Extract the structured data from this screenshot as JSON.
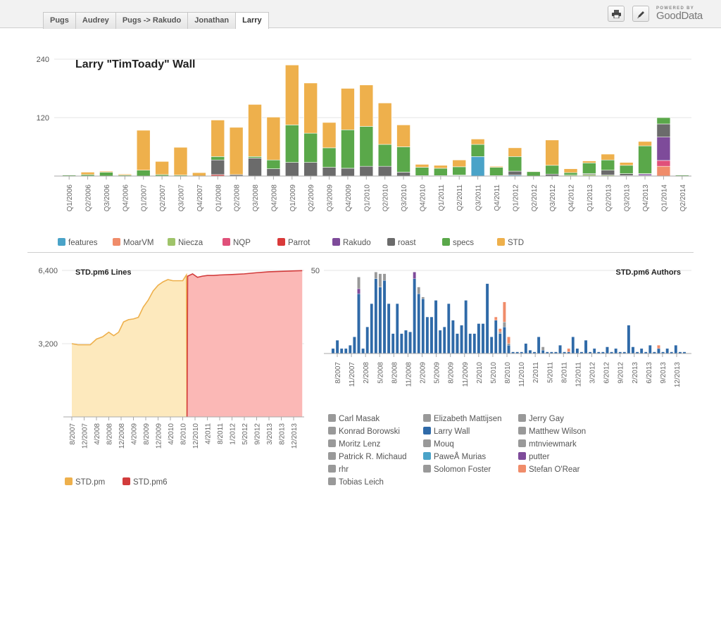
{
  "tabs": [
    "Pugs",
    "Audrey",
    "Pugs -> Rakudo",
    "Jonathan",
    "Larry"
  ],
  "active_tab": "Larry",
  "toolbar": {
    "print_icon": "printer-icon",
    "edit_icon": "pencil-icon"
  },
  "logo": {
    "powered_by": "POWERED BY",
    "brand": "GoodData"
  },
  "colors": {
    "features": "#4aa3c8",
    "MoarVM": "#f08c6a",
    "Niecza": "#9fc46a",
    "NQP": "#e0507a",
    "Parrot": "#d93a3a",
    "Rakudo": "#7e4b9a",
    "roast": "#6b6b6b",
    "specs": "#5aa84a",
    "STD": "#eeb04c",
    "std_pm_fill": "#fde9bd",
    "std_pm6_fill": "#fbb8b6",
    "std_pm6_line": "#d23c3c",
    "larry": "#2f6aa8",
    "grey": "#999999",
    "paweł": "#4aa3c8",
    "putter": "#7e4b9a",
    "stefan": "#f08c6a"
  },
  "chart_data": [
    {
      "type": "bar",
      "stacked": true,
      "title": "Larry \"TimToady\" Wall",
      "ylim": [
        0,
        240
      ],
      "yticks": [
        "240",
        "120"
      ],
      "categories": [
        "Q1/2006",
        "Q2/2006",
        "Q3/2006",
        "Q4/2006",
        "Q1/2007",
        "Q2/2007",
        "Q3/2007",
        "Q4/2007",
        "Q1/2008",
        "Q2/2008",
        "Q3/2008",
        "Q4/2008",
        "Q1/2009",
        "Q2/2009",
        "Q3/2009",
        "Q4/2009",
        "Q1/2010",
        "Q2/2010",
        "Q3/2010",
        "Q4/2010",
        "Q1/2011",
        "Q2/2011",
        "Q3/2011",
        "Q4/2011",
        "Q1/2012",
        "Q2/2012",
        "Q3/2012",
        "Q4/2012",
        "Q1/2013",
        "Q2/2013",
        "Q3/2013",
        "Q4/2013",
        "Q1/2014",
        "Q2/2014"
      ],
      "series": [
        {
          "name": "features",
          "values": [
            0,
            0,
            0,
            0,
            0,
            0,
            0,
            0,
            0,
            0,
            0,
            0,
            0,
            0,
            0,
            0,
            0,
            0,
            0,
            0,
            0,
            0,
            40,
            0,
            2,
            0,
            0,
            0,
            0,
            0,
            0,
            0,
            0,
            0
          ]
        },
        {
          "name": "MoarVM",
          "values": [
            0,
            0,
            0,
            0,
            0,
            0,
            0,
            0,
            0,
            0,
            0,
            0,
            0,
            0,
            0,
            0,
            0,
            0,
            0,
            0,
            0,
            0,
            0,
            0,
            0,
            0,
            0,
            0,
            0,
            0,
            0,
            0,
            20,
            0
          ]
        },
        {
          "name": "Niecza",
          "values": [
            0,
            0,
            0,
            0,
            0,
            0,
            0,
            0,
            0,
            0,
            0,
            0,
            0,
            0,
            0,
            0,
            0,
            0,
            0,
            0,
            0,
            1,
            0,
            0,
            0,
            0,
            0,
            2,
            3,
            2,
            1,
            1,
            0,
            0
          ]
        },
        {
          "name": "NQP",
          "values": [
            0,
            0,
            0,
            0,
            0,
            0,
            0,
            0,
            0,
            0,
            0,
            0,
            0,
            0,
            0,
            0,
            0,
            0,
            0,
            0,
            0,
            0,
            0,
            0,
            0,
            0,
            0,
            0,
            0,
            0,
            0,
            0,
            12,
            0
          ]
        },
        {
          "name": "Parrot",
          "values": [
            0,
            0,
            0,
            0,
            0,
            0,
            0,
            0,
            3,
            0,
            0,
            0,
            0,
            0,
            0,
            0,
            0,
            0,
            0,
            0,
            0,
            0,
            0,
            0,
            0,
            0,
            0,
            0,
            0,
            0,
            0,
            0,
            0,
            0
          ]
        },
        {
          "name": "Rakudo",
          "values": [
            0,
            0,
            0,
            0,
            0,
            0,
            0,
            0,
            0,
            0,
            0,
            0,
            0,
            0,
            0,
            0,
            0,
            0,
            0,
            0,
            0,
            0,
            0,
            0,
            0,
            0,
            0,
            0,
            0,
            0,
            0,
            3,
            48,
            0
          ]
        },
        {
          "name": "roast",
          "values": [
            0,
            0,
            0,
            0,
            0,
            0,
            0,
            0,
            30,
            3,
            37,
            15,
            28,
            28,
            18,
            16,
            20,
            20,
            8,
            1,
            1,
            1,
            0,
            1,
            8,
            0,
            4,
            0,
            2,
            10,
            4,
            1,
            27,
            0
          ]
        },
        {
          "name": "specs",
          "values": [
            2,
            3,
            8,
            2,
            12,
            3,
            2,
            0,
            7,
            0,
            3,
            18,
            77,
            60,
            40,
            79,
            82,
            45,
            52,
            17,
            15,
            17,
            25,
            17,
            30,
            9,
            18,
            5,
            22,
            21,
            17,
            57,
            13,
            2
          ]
        },
        {
          "name": "STD",
          "values": [
            0,
            5,
            2,
            2,
            82,
            27,
            57,
            7,
            75,
            97,
            107,
            88,
            123,
            103,
            52,
            85,
            85,
            85,
            45,
            6,
            6,
            14,
            11,
            2,
            18,
            1,
            52,
            8,
            4,
            12,
            6,
            9,
            0,
            0
          ]
        }
      ]
    },
    {
      "type": "area",
      "title": "STD.pm6 Lines",
      "ylim": [
        0,
        6400
      ],
      "yticks": [
        "6,400",
        "3,200"
      ],
      "xticks": [
        "8/2007",
        "12/2007",
        "4/2008",
        "8/2008",
        "12/2008",
        "4/2009",
        "8/2009",
        "12/2009",
        "4/2010",
        "8/2010",
        "12/2010",
        "4/2011",
        "8/2011",
        "1/2012",
        "5/2012",
        "9/2012",
        "3/2013",
        "8/2013",
        "12/2013"
      ],
      "series": [
        {
          "name": "STD.pm",
          "points": [
            [
              0,
              3200
            ],
            [
              0.5,
              3150
            ],
            [
              1,
              3150
            ],
            [
              1.5,
              3150
            ],
            [
              2,
              3400
            ],
            [
              2.5,
              3500
            ],
            [
              3,
              3700
            ],
            [
              3.4,
              3550
            ],
            [
              3.8,
              3700
            ],
            [
              4.2,
              4150
            ],
            [
              4.6,
              4250
            ],
            [
              5,
              4280
            ],
            [
              5.4,
              4350
            ],
            [
              5.8,
              4800
            ],
            [
              6.2,
              5100
            ],
            [
              6.6,
              5500
            ],
            [
              7,
              5750
            ],
            [
              7.4,
              5900
            ],
            [
              7.8,
              6000
            ],
            [
              8.2,
              5950
            ],
            [
              8.6,
              5950
            ],
            [
              9,
              5950
            ],
            [
              9.3,
              6200
            ],
            [
              9.35,
              0
            ]
          ]
        },
        {
          "name": "STD.pm6",
          "points": [
            [
              9.35,
              0
            ],
            [
              9.4,
              6150
            ],
            [
              9.8,
              6250
            ],
            [
              10.2,
              6100
            ],
            [
              10.6,
              6150
            ],
            [
              11,
              6180
            ],
            [
              11.5,
              6180
            ],
            [
              12,
              6200
            ],
            [
              13,
              6220
            ],
            [
              14,
              6250
            ],
            [
              15,
              6300
            ],
            [
              16,
              6340
            ],
            [
              17,
              6360
            ],
            [
              18,
              6380
            ],
            [
              18.7,
              6390
            ]
          ]
        }
      ]
    },
    {
      "type": "bar",
      "stacked": true,
      "title": "STD.pm6 Authors",
      "ylim": [
        0,
        50
      ],
      "yticks": [
        "50"
      ],
      "xticks": [
        "8/2007",
        "11/2007",
        "2/2008",
        "5/2008",
        "8/2008",
        "11/2008",
        "2/2009",
        "5/2009",
        "8/2009",
        "11/2009",
        "2/2010",
        "5/2010",
        "8/2010",
        "11/2010",
        "2/2011",
        "5/2011",
        "8/2011",
        "12/2011",
        "3/2012",
        "6/2012",
        "9/2012",
        "2/2013",
        "6/2013",
        "9/2013",
        "12/2013"
      ],
      "larry_wall": [
        3,
        8,
        3,
        3,
        5,
        10,
        36,
        3,
        16,
        30,
        45,
        40,
        44,
        30,
        12,
        30,
        12,
        14,
        13,
        45,
        36,
        33,
        22,
        22,
        32,
        14,
        16,
        30,
        20,
        12,
        17,
        32,
        12,
        12,
        18,
        18,
        42,
        10,
        20,
        12,
        16,
        5,
        1,
        1,
        1,
        6,
        2,
        1,
        10,
        2,
        1,
        1,
        1,
        5,
        1,
        1,
        10,
        3,
        1,
        8,
        1,
        3,
        1,
        1,
        4,
        1,
        3,
        1,
        1,
        17,
        4,
        1,
        3,
        1,
        5,
        1,
        3,
        1,
        3,
        1,
        5,
        1,
        1
      ],
      "other_authors": [
        0,
        0,
        0,
        0,
        0,
        0,
        7,
        0,
        0,
        0,
        4,
        8,
        4,
        0,
        0,
        0,
        0,
        0,
        0,
        0,
        4,
        1,
        0,
        0,
        0,
        0,
        0,
        0,
        0,
        0,
        0,
        0,
        0,
        0,
        0,
        0,
        0,
        0,
        0,
        1,
        3,
        1,
        0,
        0,
        0,
        0,
        0,
        0,
        0,
        2,
        0,
        0,
        0,
        0,
        0,
        0,
        0,
        0,
        0,
        0,
        0,
        0,
        0,
        0,
        0,
        0,
        0,
        0,
        0,
        0,
        0,
        0,
        0,
        0,
        0,
        0,
        0,
        0,
        0,
        0,
        0,
        0,
        0
      ],
      "stefan_orear": [
        0,
        0,
        0,
        0,
        0,
        0,
        0,
        0,
        0,
        0,
        0,
        0,
        0,
        0,
        0,
        0,
        0,
        0,
        0,
        0,
        0,
        0,
        0,
        0,
        0,
        0,
        0,
        0,
        0,
        0,
        0,
        0,
        0,
        0,
        0,
        0,
        0,
        0,
        2,
        2,
        12,
        4,
        0,
        0,
        0,
        0,
        0,
        0,
        0,
        0,
        0,
        0,
        0,
        0,
        0,
        2,
        0,
        0,
        0,
        0,
        0,
        0,
        0,
        0,
        0,
        0,
        0,
        0,
        0,
        0,
        0,
        0,
        0,
        0,
        0,
        0,
        2,
        0,
        0,
        0,
        0,
        0,
        0
      ],
      "putter": [
        0,
        0,
        0,
        0,
        0,
        0,
        3,
        0,
        0,
        0,
        0,
        0,
        0,
        0,
        0,
        0,
        0,
        0,
        0,
        4,
        0,
        0,
        0,
        0,
        0,
        0,
        0,
        0,
        0,
        0,
        0,
        0,
        0,
        0,
        0,
        0,
        0,
        0,
        0,
        0,
        0,
        0,
        0,
        0,
        0,
        0,
        0,
        0,
        0,
        0,
        0,
        0,
        0,
        0,
        0,
        0,
        0,
        0,
        0,
        0,
        0,
        0,
        0,
        0,
        0,
        0,
        0,
        0,
        0,
        0,
        0,
        0,
        0,
        0,
        0,
        0,
        0,
        0,
        0,
        0,
        0,
        0,
        0
      ]
    }
  ],
  "legend1": [
    {
      "label": "features",
      "color": "#4aa3c8"
    },
    {
      "label": "MoarVM",
      "color": "#f08c6a"
    },
    {
      "label": "Niecza",
      "color": "#9fc46a"
    },
    {
      "label": "NQP",
      "color": "#e0507a"
    },
    {
      "label": "Parrot",
      "color": "#d93a3a"
    },
    {
      "label": "Rakudo",
      "color": "#7e4b9a"
    },
    {
      "label": "roast",
      "color": "#6b6b6b"
    },
    {
      "label": "specs",
      "color": "#5aa84a"
    },
    {
      "label": "STD",
      "color": "#eeb04c"
    }
  ],
  "legend2": [
    {
      "label": "STD.pm",
      "color": "#eeb04c"
    },
    {
      "label": "STD.pm6",
      "color": "#d23c3c"
    }
  ],
  "legend3": [
    {
      "label": "Carl Masak",
      "color": "#999999"
    },
    {
      "label": "Elizabeth Mattijsen",
      "color": "#999999"
    },
    {
      "label": "Jerry Gay",
      "color": "#999999"
    },
    {
      "label": "Konrad Borowski",
      "color": "#999999"
    },
    {
      "label": "Larry Wall",
      "color": "#2f6aa8"
    },
    {
      "label": "Matthew Wilson",
      "color": "#999999"
    },
    {
      "label": "Moritz Lenz",
      "color": "#999999"
    },
    {
      "label": "Mouq",
      "color": "#999999"
    },
    {
      "label": "mtnviewmark",
      "color": "#999999"
    },
    {
      "label": "Patrick R. Michaud",
      "color": "#999999"
    },
    {
      "label": "PaweÅ Murias",
      "color": "#4aa3c8"
    },
    {
      "label": "putter",
      "color": "#7e4b9a"
    },
    {
      "label": "rhr",
      "color": "#999999"
    },
    {
      "label": "Solomon Foster",
      "color": "#999999"
    },
    {
      "label": "Stefan O'Rear",
      "color": "#f08c6a"
    },
    {
      "label": "Tobias Leich",
      "color": "#999999"
    }
  ]
}
